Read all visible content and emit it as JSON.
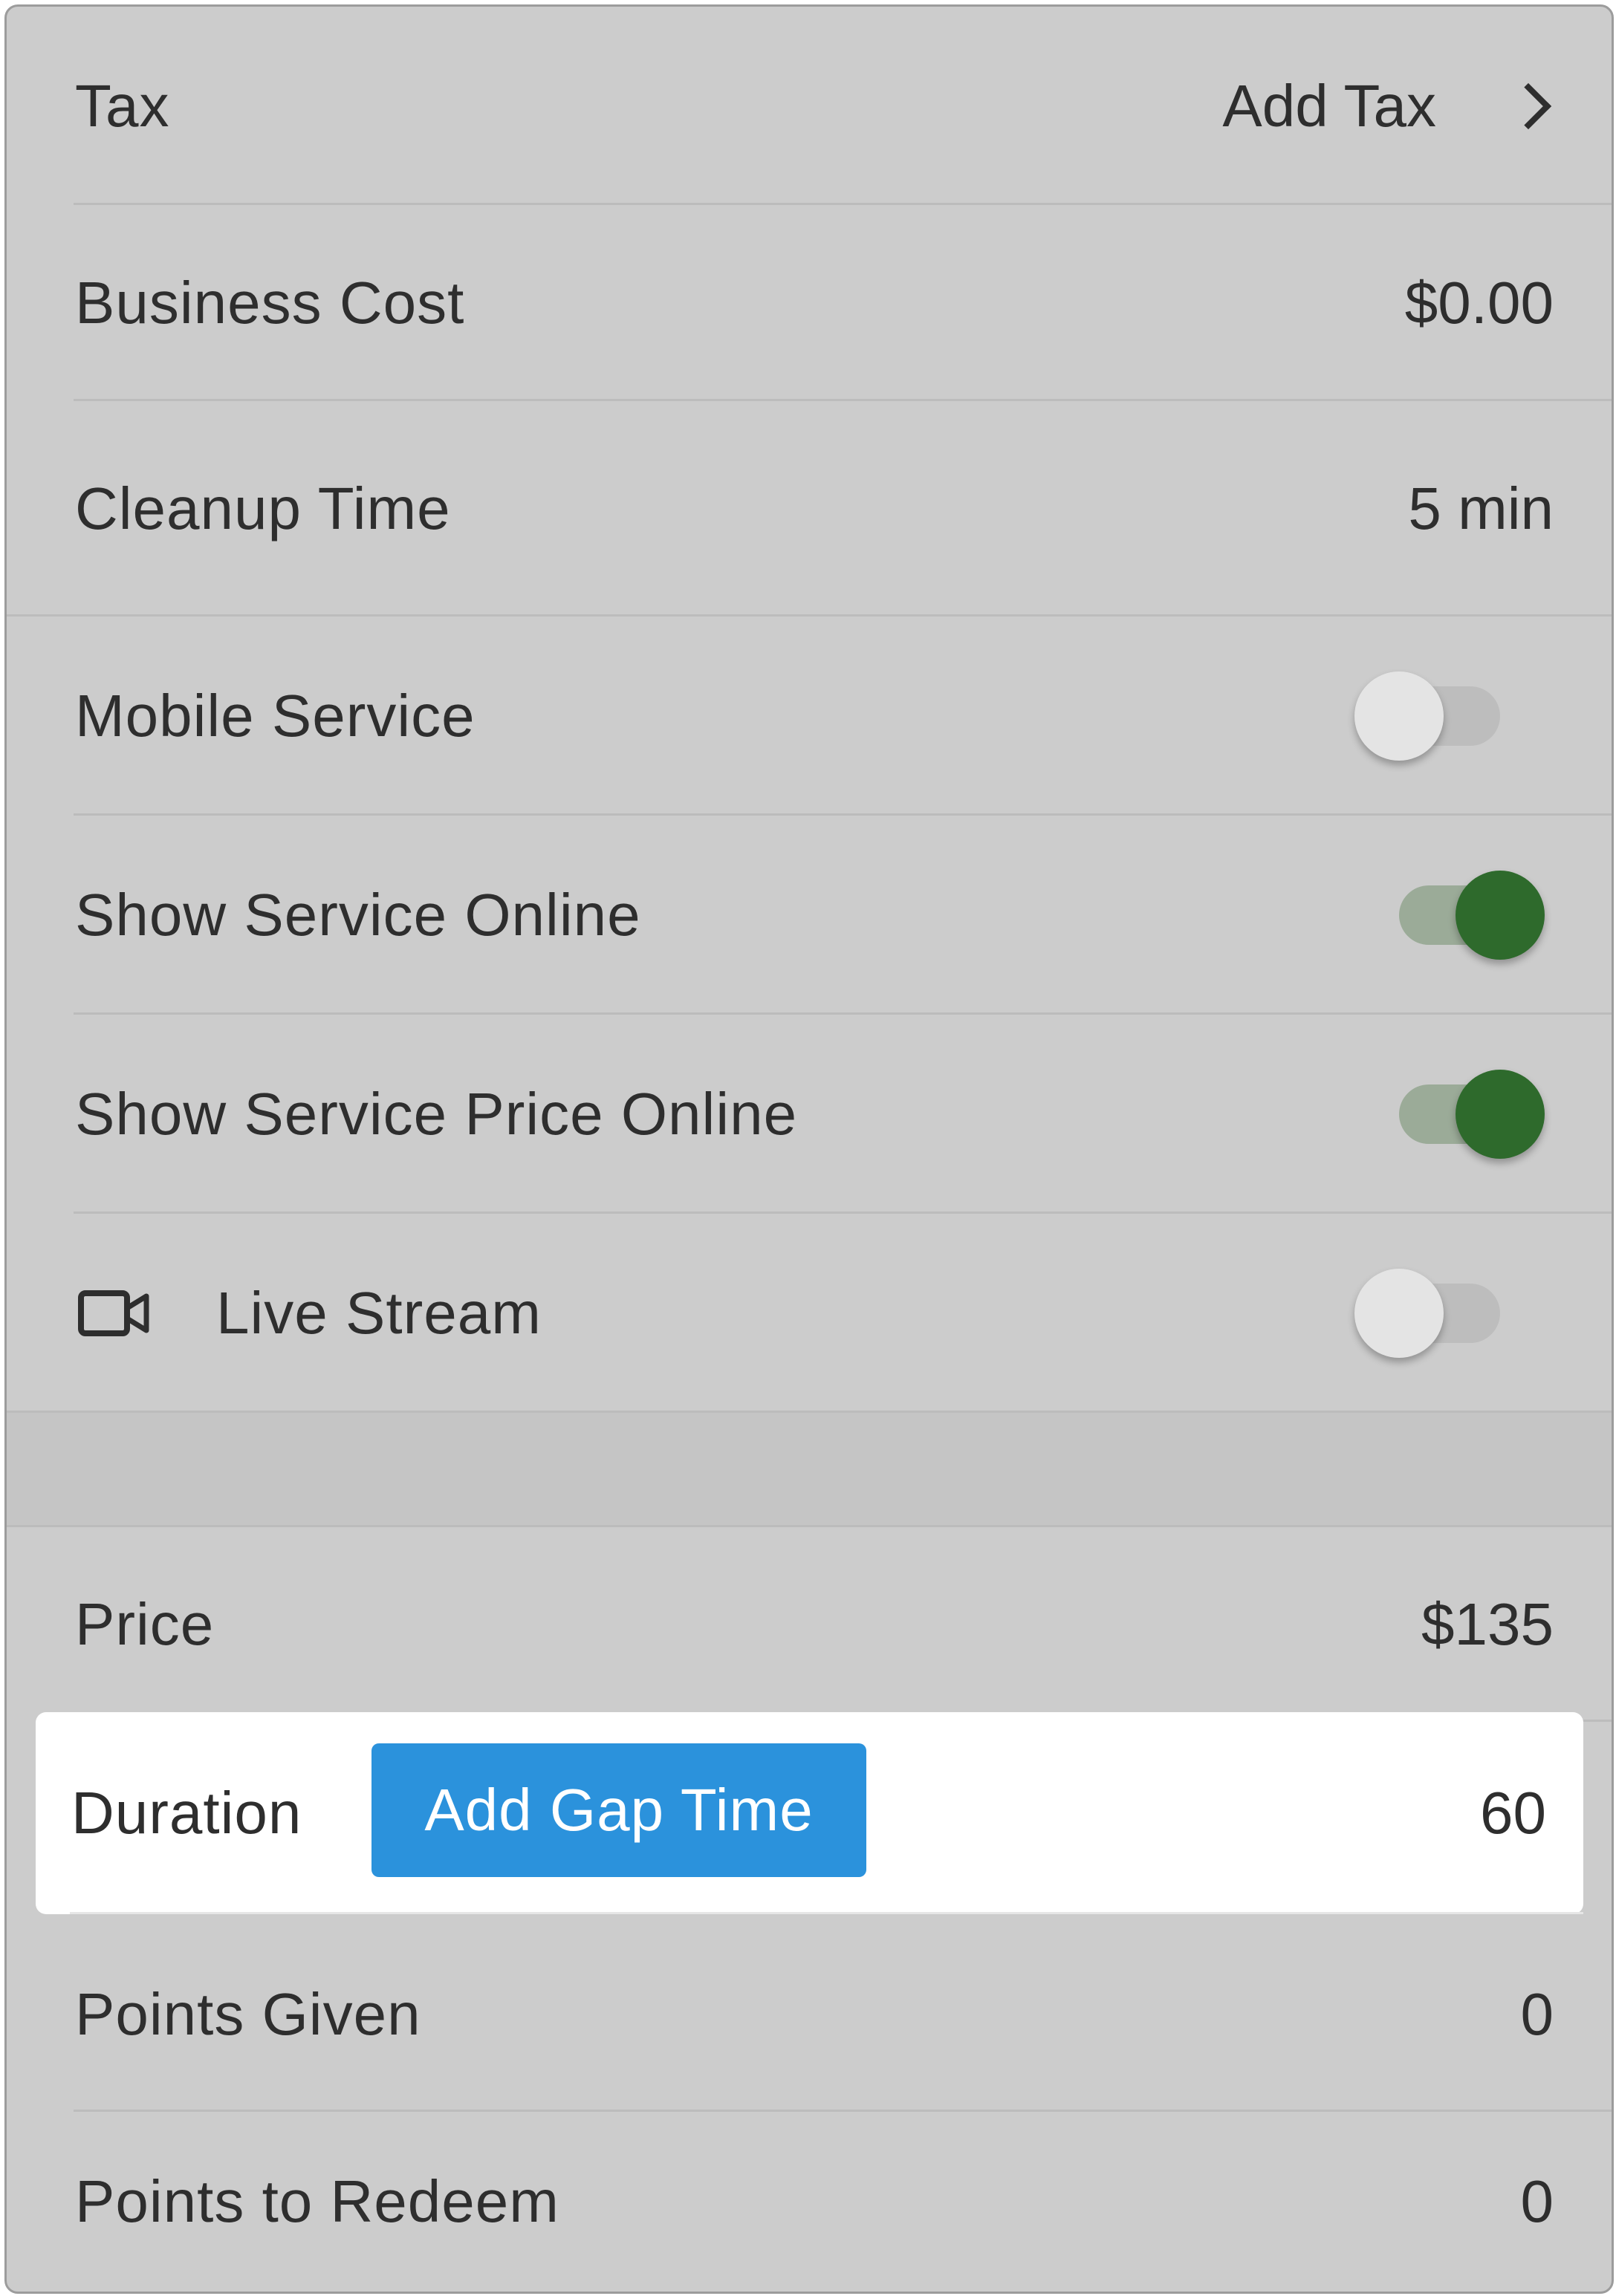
{
  "rows": {
    "tax": {
      "label": "Tax",
      "value": "Add Tax"
    },
    "business_cost": {
      "label": "Business Cost",
      "value": "$0.00"
    },
    "cleanup_time": {
      "label": "Cleanup Time",
      "value": "5 min"
    },
    "mobile_service": {
      "label": "Mobile Service",
      "enabled": false
    },
    "show_service_online": {
      "label": "Show Service Online",
      "enabled": true
    },
    "show_service_price_online": {
      "label": "Show Service Price Online",
      "enabled": true
    },
    "live_stream": {
      "label": "Live Stream",
      "enabled": false,
      "icon": "video-camera-icon"
    },
    "price": {
      "label": "Price",
      "value": "$135"
    },
    "duration": {
      "label": "Duration",
      "button_label": "Add Gap Time",
      "value": "60"
    },
    "points_given": {
      "label": "Points Given",
      "value": "0"
    },
    "points_to_redeem": {
      "label": "Points to Redeem",
      "value": "0"
    }
  },
  "colors": {
    "toggle_on_knob": "#2e6a2c",
    "toggle_on_track": "#9bab98",
    "button_blue": "#2b92dc",
    "panel_bg": "#cccccc"
  }
}
